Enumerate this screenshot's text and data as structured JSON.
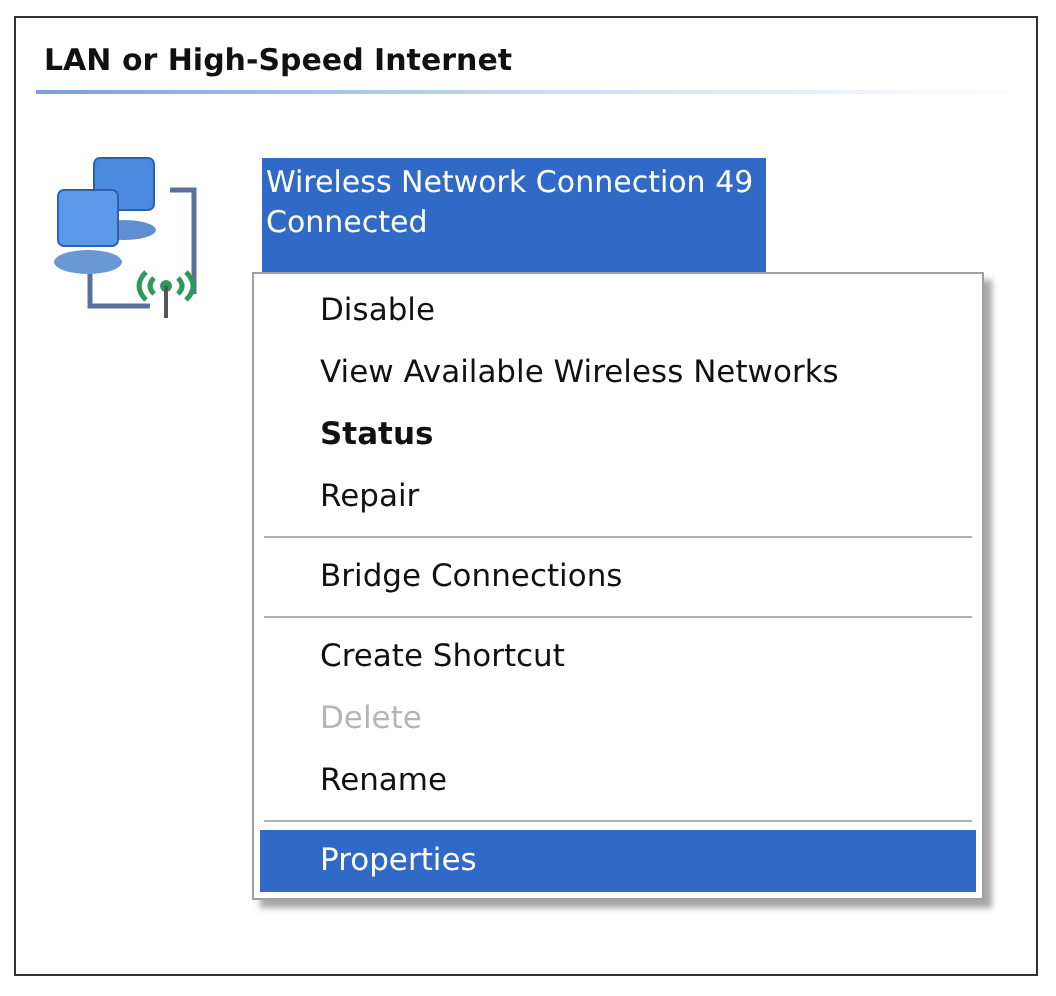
{
  "section": {
    "title": "LAN or High-Speed Internet"
  },
  "connection": {
    "name": "Wireless Network Connection 49",
    "status": "Connected",
    "selected": true
  },
  "context_menu": {
    "items": [
      {
        "kind": "item",
        "label": "Disable",
        "default": false,
        "disabled": false,
        "selected": false
      },
      {
        "kind": "item",
        "label": "View Available Wireless Networks",
        "default": false,
        "disabled": false,
        "selected": false
      },
      {
        "kind": "item",
        "label": "Status",
        "default": true,
        "disabled": false,
        "selected": false
      },
      {
        "kind": "item",
        "label": "Repair",
        "default": false,
        "disabled": false,
        "selected": false
      },
      {
        "kind": "separator"
      },
      {
        "kind": "item",
        "label": "Bridge Connections",
        "default": false,
        "disabled": false,
        "selected": false
      },
      {
        "kind": "separator"
      },
      {
        "kind": "item",
        "label": "Create Shortcut",
        "default": false,
        "disabled": false,
        "selected": false
      },
      {
        "kind": "item",
        "label": "Delete",
        "default": false,
        "disabled": true,
        "selected": false
      },
      {
        "kind": "item",
        "label": "Rename",
        "default": false,
        "disabled": false,
        "selected": false
      },
      {
        "kind": "separator"
      },
      {
        "kind": "item",
        "label": "Properties",
        "default": false,
        "disabled": false,
        "selected": true
      }
    ]
  }
}
